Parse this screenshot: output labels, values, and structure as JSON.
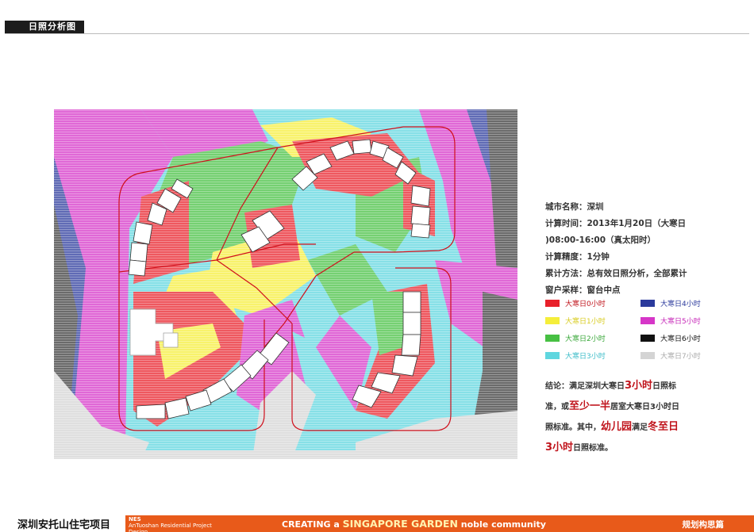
{
  "header": {
    "title": "日照分析图"
  },
  "info": {
    "city": "城市名称：深圳",
    "time_1": "计算时间：2013年1月20日（大寒日",
    "time_2": ")08:00-16:00（真太阳时）",
    "precision": "计算精度：1分钟",
    "method": "累计方法：总有效日照分析，全部累计",
    "sampling": "窗户采样：窗台中点"
  },
  "legend": [
    {
      "label": "大寒日0小时",
      "color": "#e8202a"
    },
    {
      "label": "大寒日4小时",
      "color": "#2b3a9c"
    },
    {
      "label": "大寒日1小时",
      "color": "#f5ee3a"
    },
    {
      "label": "大寒日5小时",
      "color": "#d636c8"
    },
    {
      "label": "大寒日2小时",
      "color": "#47c043"
    },
    {
      "label": "大寒日6小时",
      "color": "#111111"
    },
    {
      "label": "大寒日3小时",
      "color": "#5fd6df"
    },
    {
      "label": "大寒日7小时",
      "color": "#d4d4d4"
    }
  ],
  "conclusion": {
    "p1": "结论：满足深圳大寒日",
    "h1": "3小时",
    "p2": "日照标",
    "p3": "准，或",
    "h2": "至少一半",
    "p4": "居室大寒日3小时日",
    "p5": "照标准。其中，",
    "h3": "幼儿园",
    "p6": "满足",
    "h4": "冬至日",
    "h5": "3小时",
    "p7": "日照标准。"
  },
  "footer": {
    "project_cn": "深圳安托山住宅项目",
    "logo": "NES",
    "project_en": "AnTuoshan Residential Project Design",
    "slogan_a": "CREATING a ",
    "slogan_b": "SINGAPORE GARDEN",
    "slogan_c": " noble community",
    "section": "规划构思篇"
  }
}
